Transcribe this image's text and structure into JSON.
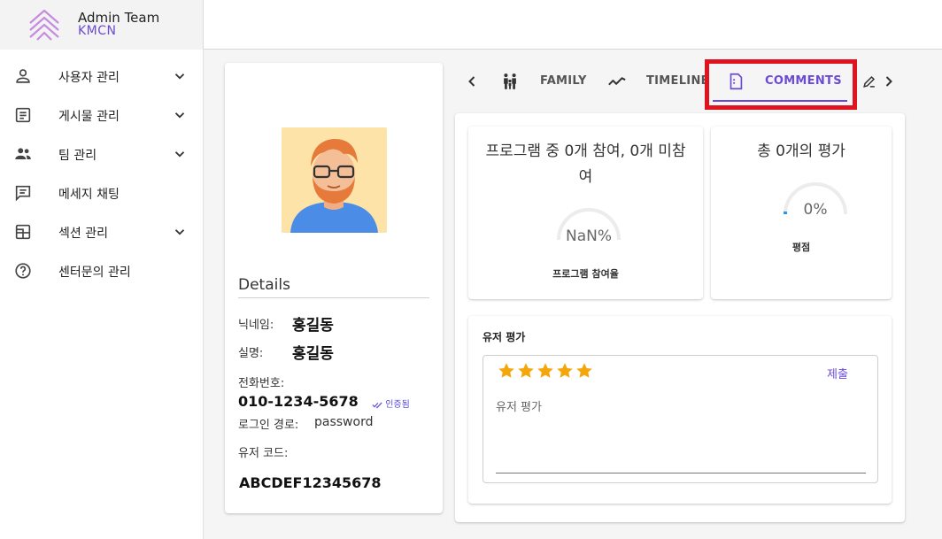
{
  "brand": {
    "title": "Admin Team",
    "subtitle": "KMCN",
    "accent": "#6b4bd6",
    "logo_icon": "chevron-stack-logo"
  },
  "sidebar": {
    "items": [
      {
        "label": "사용자 관리",
        "icon": "person-icon",
        "expandable": true
      },
      {
        "label": "게시물 관리",
        "icon": "document-icon",
        "expandable": true
      },
      {
        "label": "팀 관리",
        "icon": "group-icon",
        "expandable": true
      },
      {
        "label": "메세지 채팅",
        "icon": "chat-icon",
        "expandable": false
      },
      {
        "label": "섹션 관리",
        "icon": "layout-icon",
        "expandable": true
      },
      {
        "label": "센터문의 관리",
        "icon": "help-icon",
        "expandable": false
      }
    ]
  },
  "profile": {
    "details_title": "Details",
    "nickname_label": "닉네임:",
    "nickname": "홍길동",
    "realname_label": "실명:",
    "realname": "홍길동",
    "phone_label": "전화번호:",
    "phone": "010-1234-5678",
    "verified_label": "인증됨",
    "login_label": "로그인 경로:",
    "login_value": "password",
    "usercode_label": "유저 코드:",
    "usercode": "ABCDEF12345678"
  },
  "tabs": {
    "items": [
      {
        "label": "FAMILY",
        "icon": "family-icon",
        "active": false
      },
      {
        "label": "TIMELINE",
        "icon": "timeline-icon",
        "active": false
      },
      {
        "label": "COMMENTS",
        "icon": "comments-icon",
        "active": true
      }
    ],
    "highlight_color": "#e0141e"
  },
  "stats": {
    "program": {
      "title": "프로그램 중 0개 참여, 0개 미참여",
      "value": "NaN%",
      "caption": "프로그램 참여율"
    },
    "rating": {
      "title": "총 0개의 평가",
      "value": "0%",
      "caption": "평점"
    }
  },
  "review": {
    "title": "유저 평가",
    "stars": 5,
    "star_color": "#f5a60a",
    "submit_label": "제출",
    "placeholder": "유저 평가"
  }
}
